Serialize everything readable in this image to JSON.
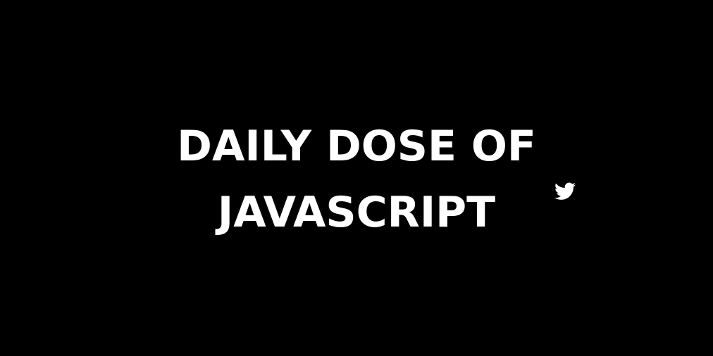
{
  "title": {
    "line1": "DAILY DOSE OF",
    "line2": "JAVASCRIPT"
  },
  "icon": {
    "name": "twitter-icon"
  },
  "colors": {
    "background": "#000000",
    "text": "#ffffff"
  }
}
